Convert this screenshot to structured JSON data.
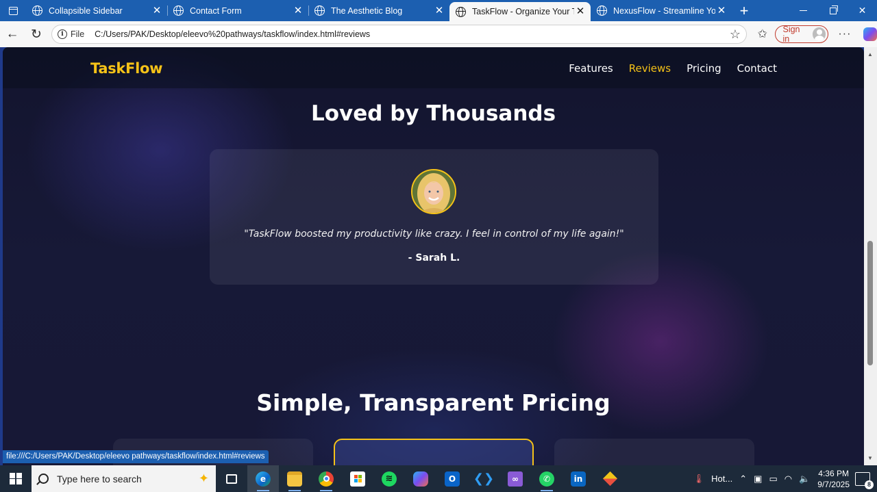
{
  "browser": {
    "tabs": [
      {
        "title": "Collapsible Sidebar",
        "active": false
      },
      {
        "title": "Contact Form",
        "active": false
      },
      {
        "title": "The Aesthetic Blog",
        "active": false
      },
      {
        "title": "TaskFlow - Organize Your Task",
        "active": true
      },
      {
        "title": "NexusFlow - Streamline Your W",
        "active": false
      }
    ],
    "address": {
      "scheme_label": "File",
      "url": "C:/Users/PAK/Desktop/eleevo%20pathways/taskflow/index.html#reviews"
    },
    "signin_label": "Sign in",
    "status_url": "file:///C:/Users/PAK/Desktop/eleevo pathways/taskflow/index.html#reviews",
    "colors": {
      "tabstrip": "#1c5fb0",
      "toolbar": "#f7f7f7",
      "signin": "#c0392b"
    }
  },
  "page": {
    "brand": "TaskFlow",
    "nav": [
      {
        "label": "Features",
        "active": false
      },
      {
        "label": "Reviews",
        "active": true
      },
      {
        "label": "Pricing",
        "active": false
      },
      {
        "label": "Contact",
        "active": false
      }
    ],
    "reviews": {
      "title": "Loved by Thousands",
      "quote": "\"TaskFlow boosted my productivity like crazy. I feel in control of my life again!\"",
      "author": "- Sarah L."
    },
    "pricing": {
      "title": "Simple, Transparent Pricing"
    },
    "colors": {
      "accent": "#f5c218",
      "background": "#171937"
    }
  },
  "taskbar": {
    "search_placeholder": "Type here to search",
    "apps": [
      "task-view-icon",
      "edge-icon",
      "file-explorer-icon",
      "chrome-icon",
      "microsoft-store-icon",
      "spotify-icon",
      "copilot-icon",
      "outlook-icon",
      "vscode-icon",
      "visual-studio-icon",
      "whatsapp-icon",
      "linkedin-icon",
      "git-icon"
    ],
    "weather_label": "Hot...",
    "time": "4:36 PM",
    "date": "9/7/2025",
    "notification_count": "8"
  }
}
